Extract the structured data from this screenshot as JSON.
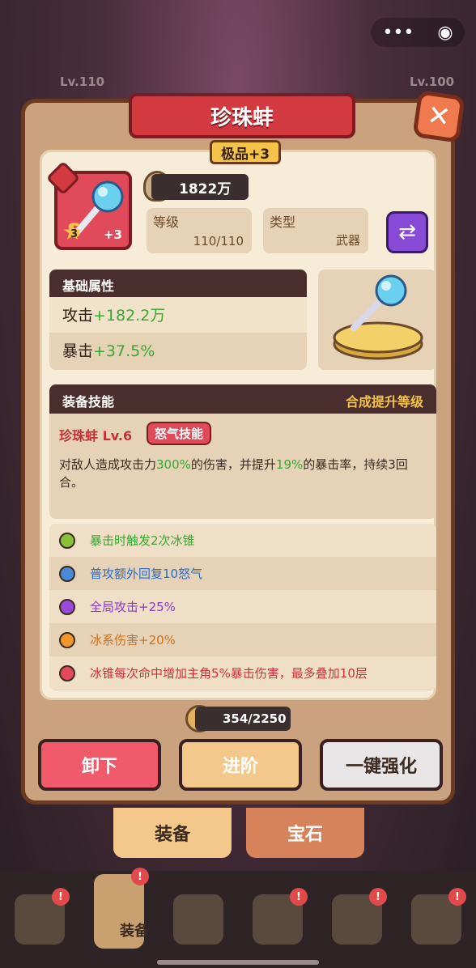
{
  "background": {
    "lv_left": "Lv.110",
    "lv_right": "Lv.100"
  },
  "topbar": {
    "menu_icon": "•••",
    "record_icon": "◉"
  },
  "item": {
    "name": "珍珠蚌",
    "grade": "极品+3",
    "stars": "3",
    "plus": "+3",
    "letter": "S",
    "power": "1822万",
    "level_label": "等级",
    "level_value": "110/110",
    "type_label": "类型",
    "type_value": "武器"
  },
  "attributes": {
    "header": "基础属性",
    "rows": [
      {
        "name": "攻击",
        "value": "+182.2万"
      },
      {
        "name": "暴击",
        "value": "+37.5%"
      }
    ]
  },
  "skill": {
    "header": "装备技能",
    "header_right": "合成提升等级",
    "name": "珍珠蚌 Lv.6",
    "tag": "怒气技能",
    "desc_a": "对敌人造成攻击力",
    "desc_b": "300%",
    "desc_c": "的伤害，并提升",
    "desc_d": "19%",
    "desc_e": "的暴击率，持续3回合。"
  },
  "effects": [
    {
      "text": "暴击时触发2次冰锥",
      "color": "#3aa632",
      "dot": "#8ac03a"
    },
    {
      "text": "普攻额外回复10怒气",
      "color": "#2a6ac8",
      "dot": "#4a8ad8"
    },
    {
      "text": "全局攻击+25%",
      "color": "#8a3ac8",
      "dot": "#9a4ad8"
    },
    {
      "text": "冰系伤害+20%",
      "color": "#d0701a",
      "dot": "#f0962a"
    },
    {
      "text": "冰锥每次命中增加主角5%暴击伤害，最多叠加10层",
      "color": "#d0303a",
      "dot": "#e04a5a"
    }
  ],
  "progress": {
    "text": "354/2250"
  },
  "buttons": {
    "unequip": "卸下",
    "advance": "进阶",
    "enhance": "一键强化"
  },
  "tabs": {
    "equipment": "装备",
    "gem": "宝石"
  },
  "nav": {
    "active_label": "装备",
    "badge": "!"
  }
}
